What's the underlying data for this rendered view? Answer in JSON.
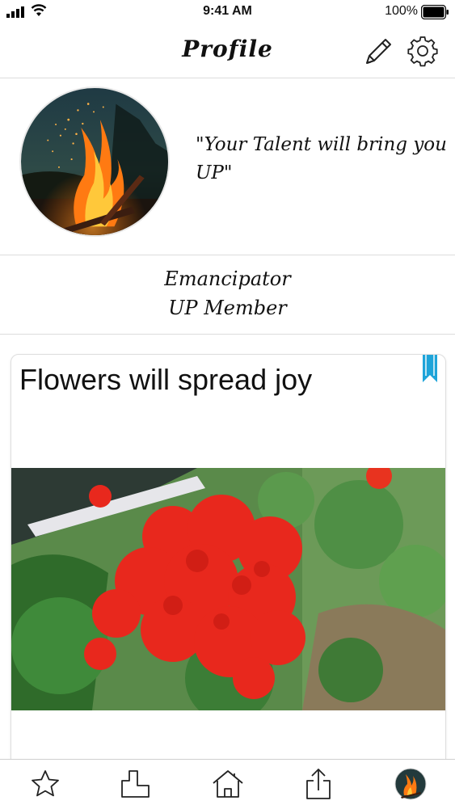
{
  "status_bar": {
    "time": "9:41 AM",
    "battery": "100%"
  },
  "header": {
    "title": "Profile",
    "icons": [
      "pencil-icon",
      "gear-icon"
    ]
  },
  "profile": {
    "avatar": "campfire-photo",
    "quote": "\"Your Talent will bring you UP\""
  },
  "member": {
    "name": "Emancipator",
    "role": "UP Member"
  },
  "post": {
    "title": "Flowers will spread joy",
    "image": "red-geranium-photo",
    "bookmarked": true
  },
  "tab_bar": {
    "items": [
      "star-icon",
      "puzzle-icon",
      "home-icon",
      "share-icon",
      "avatar-icon"
    ]
  },
  "colors": {
    "bookmark": "#1ea4d9",
    "flower": "#e8281d",
    "leaf": "#3f8a3a"
  }
}
